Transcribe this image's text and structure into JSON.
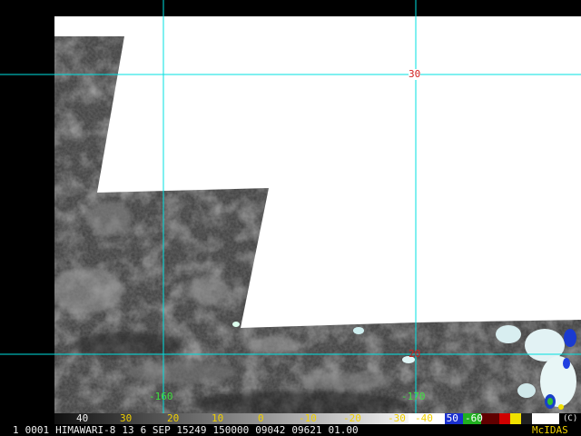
{
  "map": {
    "latitude_labels": [
      "30",
      "20"
    ],
    "longitude_labels": [
      "-160",
      "-170"
    ],
    "grid_color": "#00e0e0",
    "lat_label_color": "#d02020",
    "lon_label_color": "#40e040",
    "background": "#000000",
    "no_data_color": "#ffffff"
  },
  "colorbar": {
    "labels": [
      "40",
      "30",
      "20",
      "10",
      "0",
      "-10",
      "-20",
      "-30",
      "-40",
      "-50",
      "-60"
    ],
    "label_colors": [
      "#f0f0f0",
      "#f0d000",
      "#f0d000",
      "#f0d000",
      "#f0d000",
      "#f0d000",
      "#f0d000",
      "#f0d000",
      "#f0d000",
      "#ffffff",
      "#ffffff"
    ]
  },
  "status": {
    "frame": "1",
    "sequence": "0001",
    "satellite": "HIMAWARI-8",
    "band": "13",
    "date": "6 SEP 15249",
    "time": "150000",
    "image_number": "09042",
    "element_number": "09621",
    "resolution": "01.00",
    "software": "McIDAS",
    "copyright": "(C)"
  }
}
